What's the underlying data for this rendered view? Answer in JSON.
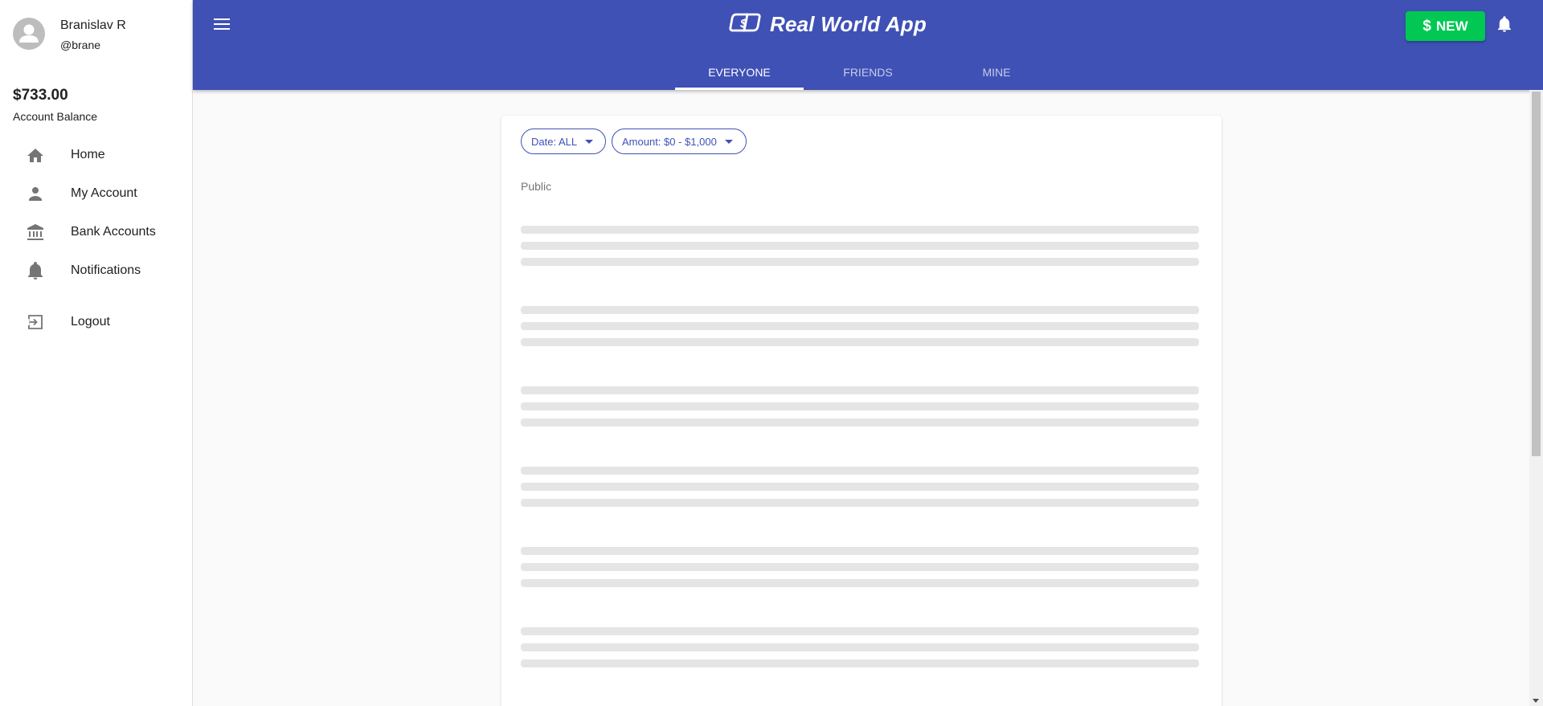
{
  "user": {
    "name": "Branislav R",
    "handle": "@brane",
    "balance": "$733.00",
    "balance_label": "Account Balance"
  },
  "sidebar": {
    "items": [
      {
        "label": "Home",
        "icon": "home-icon"
      },
      {
        "label": "My Account",
        "icon": "person-icon"
      },
      {
        "label": "Bank Accounts",
        "icon": "bank-icon"
      },
      {
        "label": "Notifications",
        "icon": "bell-icon"
      },
      {
        "label": "Logout",
        "icon": "logout-icon"
      }
    ]
  },
  "header": {
    "title": "Real World App",
    "new_label": "NEW",
    "new_symbol": "$",
    "brand_color": "#3f51b5",
    "new_color": "#00c853"
  },
  "tabs": [
    {
      "label": "EVERYONE",
      "active": true
    },
    {
      "label": "FRIENDS",
      "active": false
    },
    {
      "label": "MINE",
      "active": false
    }
  ],
  "filters": {
    "date_label": "Date: ALL",
    "amount_label": "Amount: $0 - $1,000"
  },
  "main": {
    "section_label": "Public"
  }
}
